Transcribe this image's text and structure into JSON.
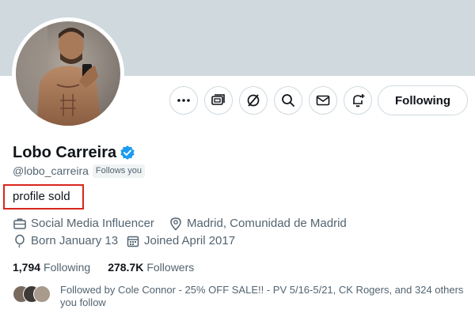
{
  "profile": {
    "display_name": "Lobo Carreira",
    "handle": "@lobo_carreira",
    "follows_you_badge": "Follows you",
    "bio": "profile sold",
    "category": "Social Media Influencer",
    "location": "Madrid, Comunidad de Madrid",
    "birthday": "Born January 13",
    "joined": "Joined April 2017"
  },
  "actions": {
    "more_icon": "more-icon",
    "subscribe_icon": "subscription-icon",
    "grok_icon": "grok-icon",
    "search_icon": "search-icon",
    "message_icon": "envelope-icon",
    "notify_icon": "bell-plus-icon",
    "following_label": "Following"
  },
  "stats": {
    "following_count": "1,794",
    "following_label": "Following",
    "followers_count": "278.7K",
    "followers_label": "Followers"
  },
  "followed_by": {
    "text": "Followed by Cole Connor - 25% OFF SALE!! - PV 5/16-5/21, CK Rogers, and 324 others you follow"
  },
  "colors": {
    "banner": "#cfd9de",
    "verified": "#1d9bf0",
    "highlight_box": "#d9261c",
    "secondary_text": "#536471"
  }
}
